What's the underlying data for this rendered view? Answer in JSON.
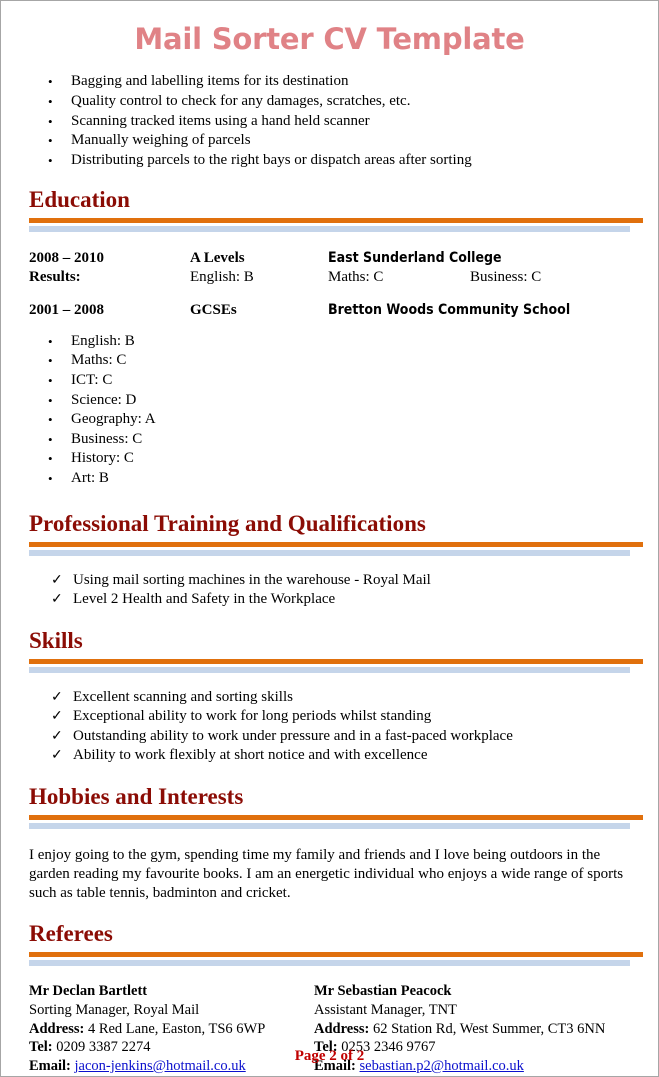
{
  "document": {
    "title": "Mail Sorter CV Template",
    "footer": "Page 2 of 2"
  },
  "duties": {
    "marker": "•",
    "items": [
      "Bagging and labelling items for its destination",
      "Quality control to check for any damages, scratches, etc.",
      "Scanning tracked items using a hand held scanner",
      "Manually weighing of parcels",
      "Distributing parcels to the right bays or dispatch areas after sorting"
    ]
  },
  "education": {
    "heading": "Education",
    "alevels": {
      "years": "2008 – 2010",
      "qualification": "A Levels",
      "institution": "East Sunderland College",
      "results_label": "Results:",
      "result1": "English: B",
      "result2": "Maths: C",
      "result3": "Business: C"
    },
    "gcses": {
      "years": "2001 – 2008",
      "qualification": "GCSEs",
      "institution": "Bretton Woods Community School"
    },
    "marker": "•",
    "grades": [
      "English: B",
      "Maths: C",
      "ICT: C",
      "Science: D",
      "Geography: A",
      "Business: C",
      "History: C",
      "Art: B"
    ]
  },
  "training": {
    "heading": "Professional Training and Qualifications",
    "marker": "✓",
    "items": [
      "Using mail sorting machines in the warehouse  - Royal Mail",
      "Level 2 Health and Safety in the Workplace"
    ]
  },
  "skills": {
    "heading": "Skills",
    "marker": "✓",
    "items": [
      "Excellent scanning and sorting skills",
      "Exceptional ability to work for long periods whilst standing",
      "Outstanding ability to work under pressure and in a fast-paced workplace",
      "Ability to work flexibly at short notice and with excellence"
    ]
  },
  "hobbies": {
    "heading": "Hobbies and Interests",
    "text": "I enjoy going to the gym, spending time my family and friends and I love being outdoors in the garden reading my favourite books. I am an energetic individual who enjoys a wide range of sports such as table tennis, badminton and cricket."
  },
  "referees": {
    "heading": "Referees",
    "labels": {
      "address": "Address:",
      "tel": "Tel:",
      "email": "Email:"
    },
    "list": [
      {
        "name": "Mr Declan Bartlett",
        "role": "Sorting Manager, Royal Mail",
        "address": "4 Red Lane, Easton, TS6 6WP",
        "tel": "0209 3387 2274",
        "email": "jacon-jenkins@hotmail.co.uk"
      },
      {
        "name": "Mr Sebastian Peacock",
        "role": "Assistant Manager, TNT",
        "address": "62 Station Rd, West Summer, CT3 6NN",
        "tel": "0253 2346 9767",
        "email": "sebastian.p2@hotmail.co.uk"
      }
    ]
  },
  "colors": {
    "title": "#e08286",
    "heading": "#8b0c05",
    "rule_orange": "#e0700d",
    "rule_blue": "#c5d5ea",
    "link": "#0b10cd",
    "footer": "#c00000"
  }
}
